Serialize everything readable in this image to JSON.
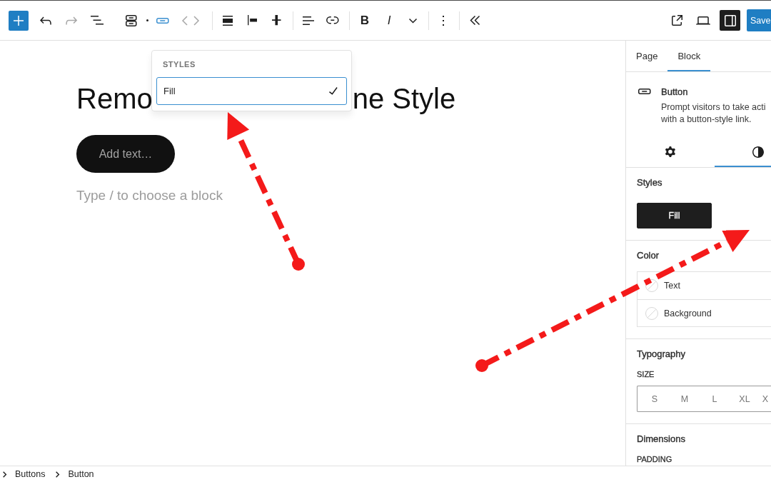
{
  "toolbar": {
    "groups": [
      {
        "tools": [
          {
            "kind": "add",
            "disabled": false
          },
          {
            "kind": "undo",
            "disabled": false
          },
          {
            "kind": "redo",
            "disabled": true
          },
          {
            "kind": "list-view",
            "disabled": false
          },
          {
            "kind": "parent",
            "disabled": false
          },
          {
            "kind": "drag",
            "disabled": false
          },
          {
            "kind": "switcher",
            "disabled": false
          },
          {
            "kind": "move-left",
            "disabled": true
          },
          {
            "kind": "move-right",
            "disabled": true
          }
        ]
      },
      {
        "tools": [
          {
            "kind": "block-align",
            "disabled": false
          },
          {
            "kind": "justify-left",
            "disabled": false
          },
          {
            "kind": "justify-center",
            "disabled": false
          }
        ]
      },
      {
        "tools": [
          {
            "kind": "text-align",
            "disabled": false
          },
          {
            "kind": "link",
            "disabled": false
          }
        ]
      },
      {
        "tools": [
          {
            "kind": "bold",
            "label": "B",
            "disabled": false
          },
          {
            "kind": "italic",
            "label": "I",
            "disabled": false
          },
          {
            "kind": "more-formats",
            "disabled": false
          }
        ]
      },
      {
        "tools": [
          {
            "kind": "options",
            "disabled": false
          }
        ]
      },
      {
        "tools": [
          {
            "kind": "collapse",
            "disabled": false
          }
        ]
      }
    ],
    "right_tools": [
      {
        "kind": "view",
        "pressed": false
      },
      {
        "kind": "preview",
        "pressed": false
      },
      {
        "kind": "settings",
        "pressed": true
      }
    ],
    "save_button": "Save"
  },
  "canvas": {
    "title_fragments": [
      "Remo",
      "ne Style"
    ],
    "button_placeholder": "Add text…",
    "paragraph": {
      "placeholder": "Type / to choose a block"
    }
  },
  "styles_popover": {
    "title": "STYLES",
    "options": [
      {
        "label": "Fill",
        "selected": true
      }
    ]
  },
  "sidebar": {
    "tabs": [
      {
        "label": "Page",
        "selected": false
      },
      {
        "label": "Block",
        "selected": true
      }
    ],
    "block_card": {
      "title": "Button",
      "description": "Prompt visitors to take acti with a button-style link."
    },
    "inspector_tabs": [
      {
        "kind": "settings",
        "selected": false
      },
      {
        "kind": "styles",
        "selected": true
      }
    ],
    "styles_panel": {
      "title": "Styles",
      "options": [
        {
          "label": "Fill",
          "selected": true
        }
      ]
    },
    "color_panel": {
      "title": "Color",
      "items": [
        {
          "label": "Text"
        },
        {
          "label": "Background"
        }
      ]
    },
    "typography_panel": {
      "title": "Typography",
      "size_label": "SIZE",
      "sizes": [
        {
          "label": "S",
          "selected": false
        },
        {
          "label": "M",
          "selected": false
        },
        {
          "label": "L",
          "selected": false
        },
        {
          "label": "XL",
          "selected": false
        },
        {
          "label": "X",
          "selected": false
        }
      ]
    },
    "dimensions_panel": {
      "title": "Dimensions",
      "padding_label": "PADDING"
    }
  },
  "breadcrumbs": [
    {
      "label": "Buttons"
    },
    {
      "label": "Button"
    }
  ],
  "annotations": [
    {
      "kind": "arrow"
    },
    {
      "kind": "arrow"
    }
  ]
}
